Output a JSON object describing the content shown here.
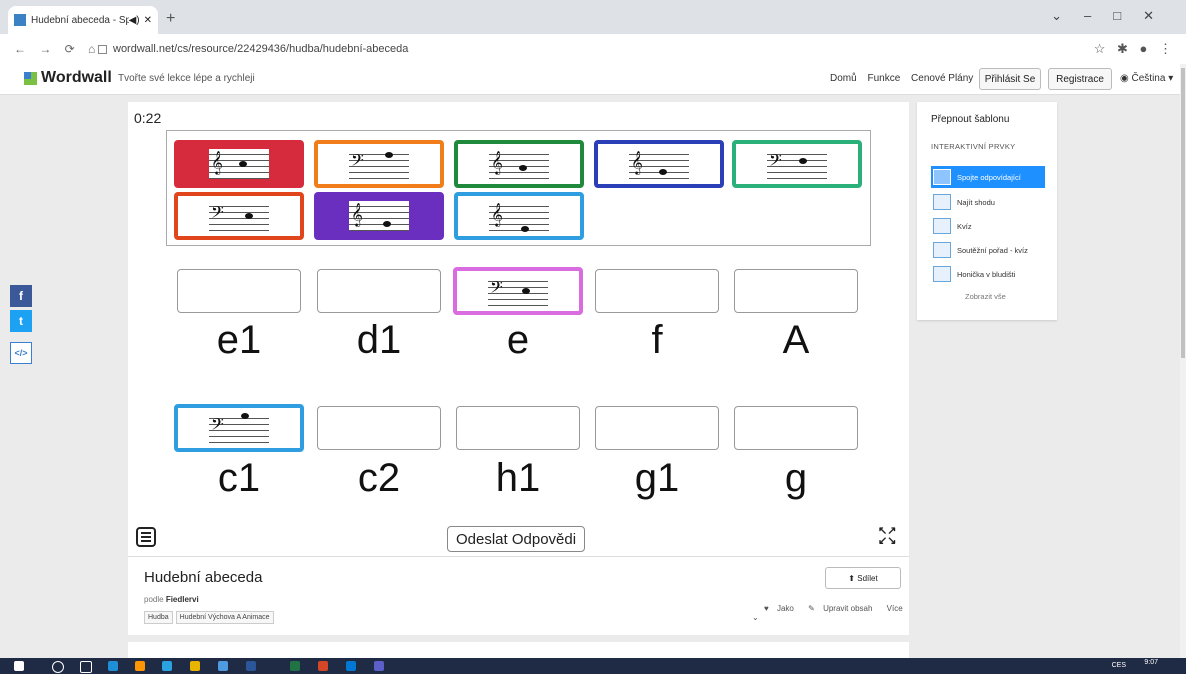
{
  "browser": {
    "tab_title": "Hudební abeceda - Spojte o",
    "url": "wordwall.net/cs/resource/22429436/hudba/hudební-abeceda"
  },
  "header": {
    "logo": "Wordwall",
    "tagline": "Tvořte své lekce lépe a rychleji",
    "nav": [
      "Domů",
      "Funkce",
      "Cenové Plány"
    ],
    "login": "Přihlásit Se",
    "register": "Registrace",
    "language": "Čeština"
  },
  "game": {
    "timer": "0:22",
    "row1_labels": [
      "e1",
      "d1",
      "e",
      "f",
      "A"
    ],
    "row2_labels": [
      "c1",
      "c2",
      "h1",
      "g1",
      "g"
    ],
    "submit_label": "Odeslat Odpovědi",
    "tray_cards": [
      {
        "color": "#d62b3c",
        "clef": "treble"
      },
      {
        "color": "#f07d1a",
        "clef": "bass"
      },
      {
        "color": "#1f8a3c",
        "clef": "treble"
      },
      {
        "color": "#2a3fb8",
        "clef": "treble"
      },
      {
        "color": "#2bb07a",
        "clef": "bass"
      },
      {
        "color": "#e0451c",
        "clef": "bass"
      },
      {
        "color": "#6a2fbf",
        "clef": "treble"
      },
      {
        "color": "#2e9ee0",
        "clef": "treble"
      }
    ],
    "placed": [
      {
        "slot": "e",
        "color": "#d86ce0",
        "clef": "bass"
      },
      {
        "slot": "c1",
        "color": "#2e9ee0",
        "clef": "bass"
      }
    ]
  },
  "info": {
    "title": "Hudební abeceda",
    "by_prefix": "podle",
    "author": "Fiedlervi",
    "tags": [
      "Hudba",
      "Hudební Výchova A Animace"
    ],
    "share": "Sdílet",
    "like": "Jako",
    "edit": "Upravit obsah",
    "more": "Více"
  },
  "sidebar": {
    "heading": "Přepnout šablonu",
    "section": "INTERAKTIVNÍ PRVKY",
    "items": [
      "Spojte odpovídající",
      "Najít shodu",
      "Kvíz",
      "Soutěžní pořad - kvíz",
      "Honička v bludišti"
    ],
    "show_all": "Zobrazit vše"
  },
  "taskbar": {
    "language": "CES",
    "time": "9:07"
  }
}
